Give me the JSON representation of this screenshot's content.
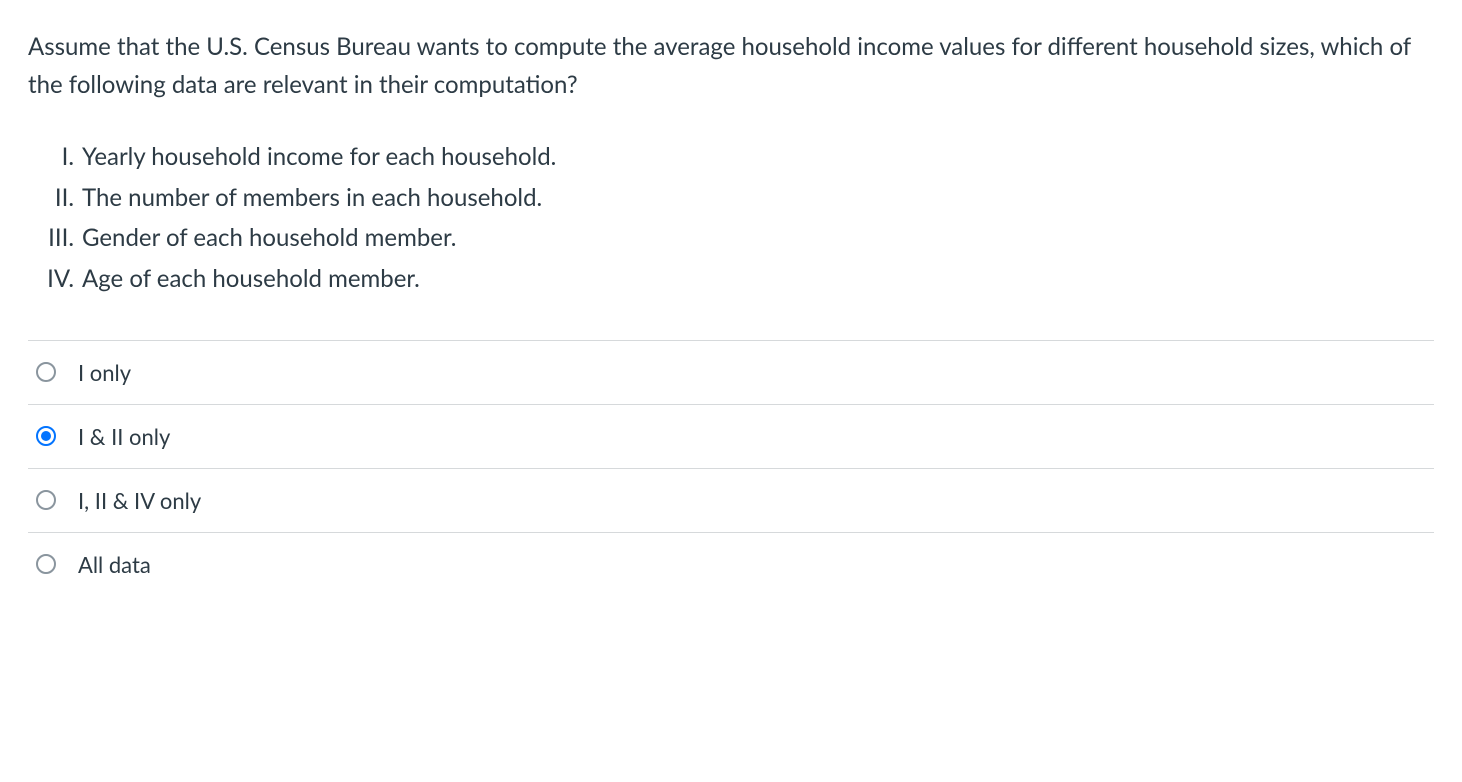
{
  "question": {
    "stem": "Assume that the U.S. Census Bureau wants to compute the average household income values for different household sizes, which of the following data are relevant in their computation?",
    "items": [
      {
        "numeral": "I.",
        "text": "Yearly household income for each household."
      },
      {
        "numeral": "II.",
        "text": "The number of members in each household."
      },
      {
        "numeral": "III.",
        "text": "Gender of each household member."
      },
      {
        "numeral": "IV.",
        "text": "Age of each household member."
      }
    ],
    "options": [
      {
        "label": "I only",
        "selected": false
      },
      {
        "label": "I & II only",
        "selected": true
      },
      {
        "label": "I, II & IV only",
        "selected": false
      },
      {
        "label": "All data",
        "selected": false
      }
    ]
  }
}
